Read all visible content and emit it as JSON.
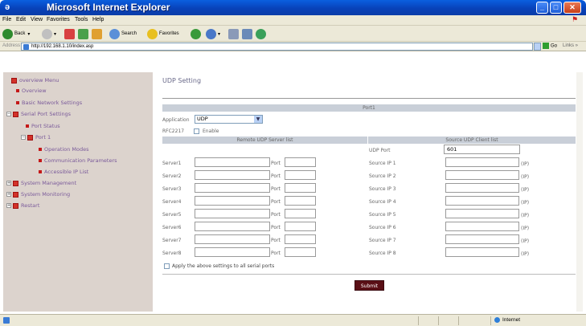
{
  "window": {
    "title": "Microsoft Internet Explorer"
  },
  "menu": [
    "File",
    "Edit",
    "View",
    "Favorites",
    "Tools",
    "Help"
  ],
  "toolbar": {
    "back": "Back",
    "search": "Search",
    "favorites": "Favorites"
  },
  "address": {
    "label": "Address",
    "url": "http://192.168.1.10/index.asp",
    "go": "Go",
    "links": "Links"
  },
  "nav": {
    "menu_title": "overview Menu",
    "overview": "Overview",
    "basic": "Basic Network Settings",
    "serial": "Serial Port Settings",
    "port_status": "Port Status",
    "port1": "Port 1",
    "operation": "Operation Modes",
    "comm": "Communication Parameters",
    "accessible": "Accessible IP List",
    "sys_mgmt": "System Management",
    "sys_mon": "System Monitoring",
    "restart": "Restart"
  },
  "page": {
    "title": "UDP Setting",
    "section_port": "Port1",
    "application_label": "Application",
    "application_value": "UDP",
    "rfc_label": "RFC2217",
    "enable_label": "Enable",
    "remote_header": "Remote UDP Server list",
    "source_header": "Source UDP Client list",
    "udp_port_label": "UDP Port",
    "udp_port_value": "601",
    "port_label": "Port",
    "ip_suffix": "(IP)",
    "servers": [
      "Server1",
      "Server2",
      "Server3",
      "Server4",
      "Server5",
      "Server6",
      "Server7",
      "Server8"
    ],
    "source_ips": [
      "Source IP 1",
      "Source IP 2",
      "Source IP 3",
      "Source IP 4",
      "Source IP 5",
      "Source IP 6",
      "Source IP 7",
      "Source IP 8"
    ],
    "apply_all": "Apply the above settings to all serial ports",
    "submit": "Submit"
  },
  "status": {
    "zone": "Internet"
  }
}
